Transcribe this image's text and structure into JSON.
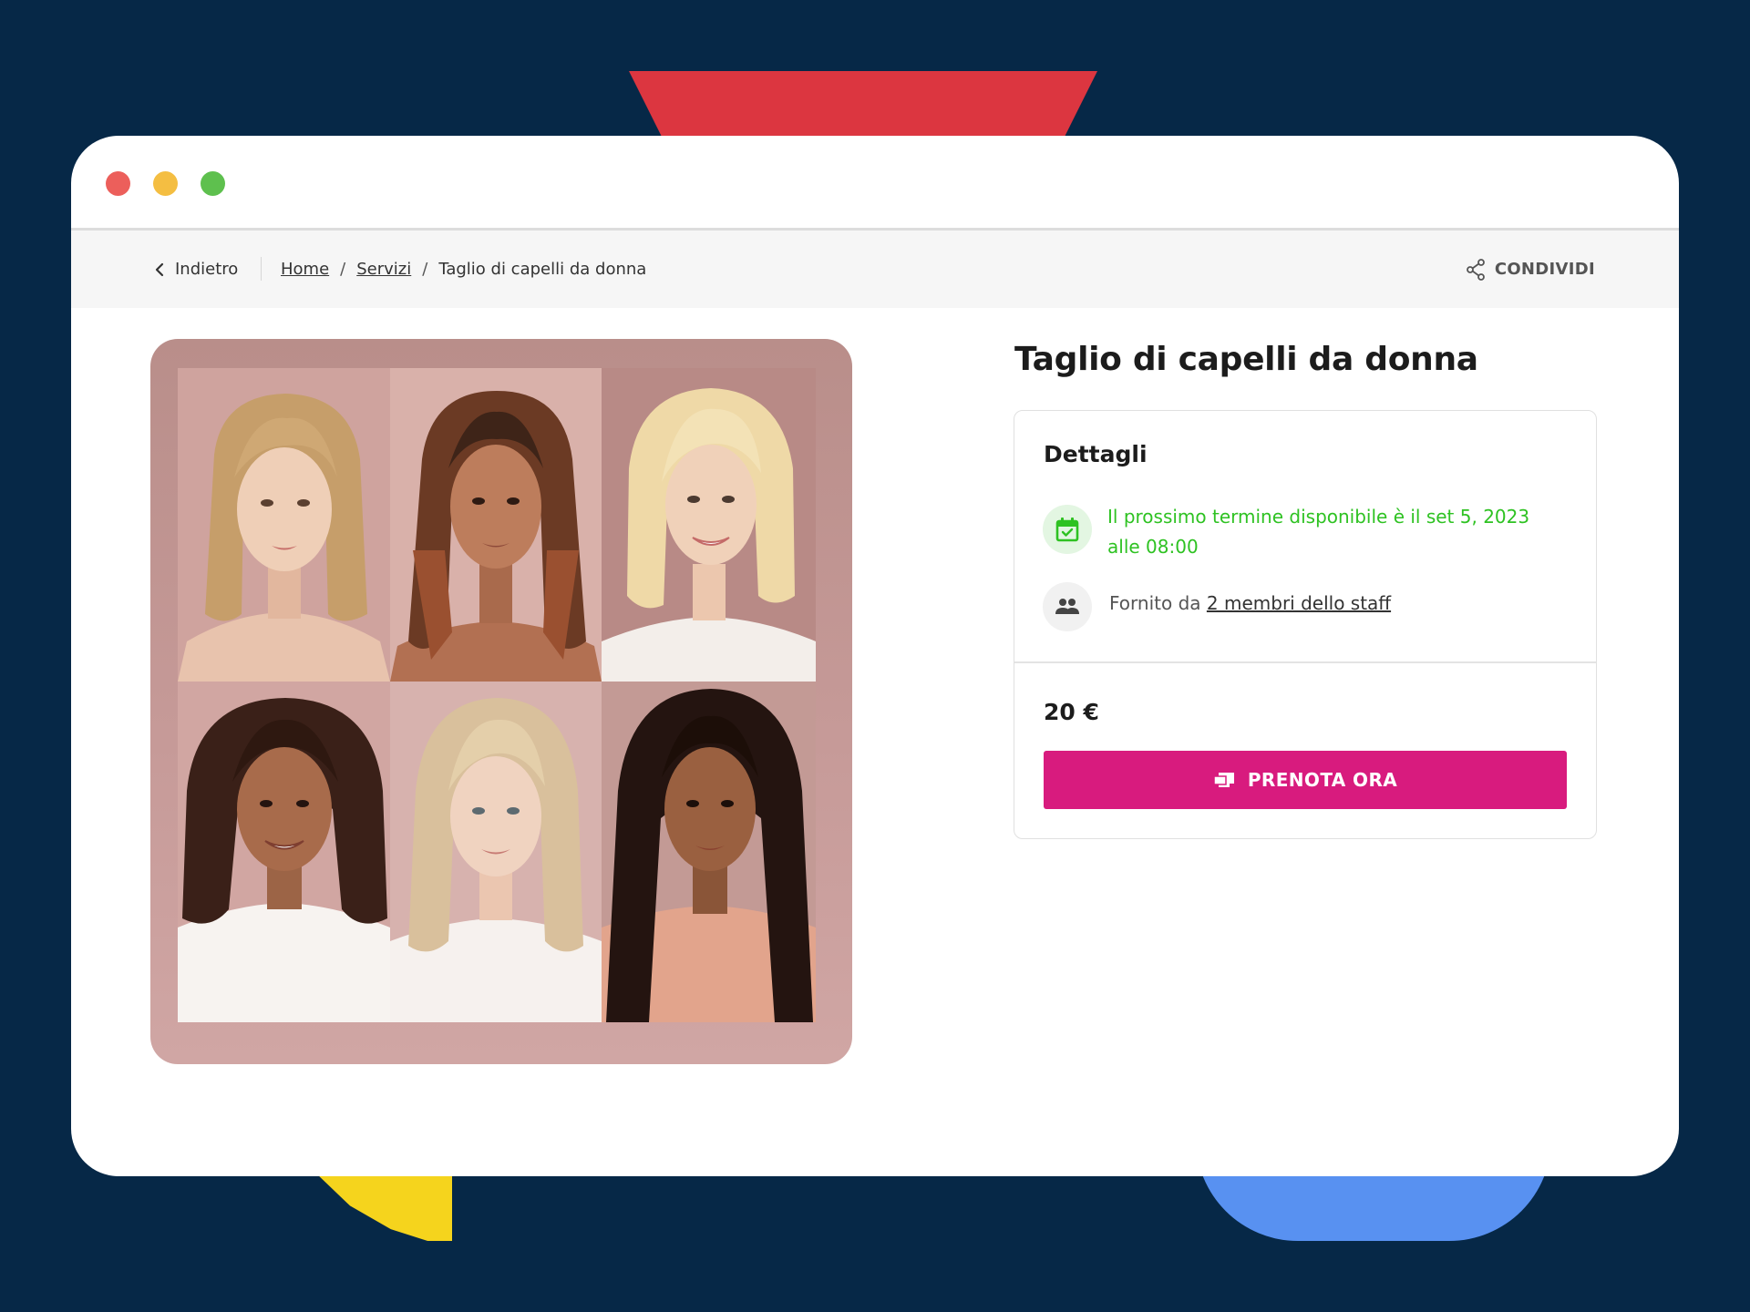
{
  "navigation": {
    "back_label": "Indietro",
    "breadcrumb": {
      "home": "Home",
      "services": "Servizi",
      "current": "Taglio di capelli da donna"
    },
    "share_label": "CONDIVIDI"
  },
  "service": {
    "title": "Taglio di capelli da donna",
    "details_heading": "Dettagli",
    "availability_text": "Il prossimo termine disponibile è il set 5, 2023 alle 08:00",
    "provided_by_prefix": "Fornito da",
    "staff_link": "2 membri dello staff",
    "price": "20 €",
    "book_label": "PRENOTA ORA"
  },
  "icons": {
    "back": "chevron-left-icon",
    "share": "share-icon",
    "calendar": "calendar-check-icon",
    "staff": "people-icon",
    "book": "ticket-icon"
  },
  "colors": {
    "page_background": "#062847",
    "accent_red": "#dc3640",
    "accent_yellow": "#f5d41d",
    "accent_blue": "#5891f1",
    "availability_green": "#2ec222",
    "book_button": "#d81b7e"
  }
}
